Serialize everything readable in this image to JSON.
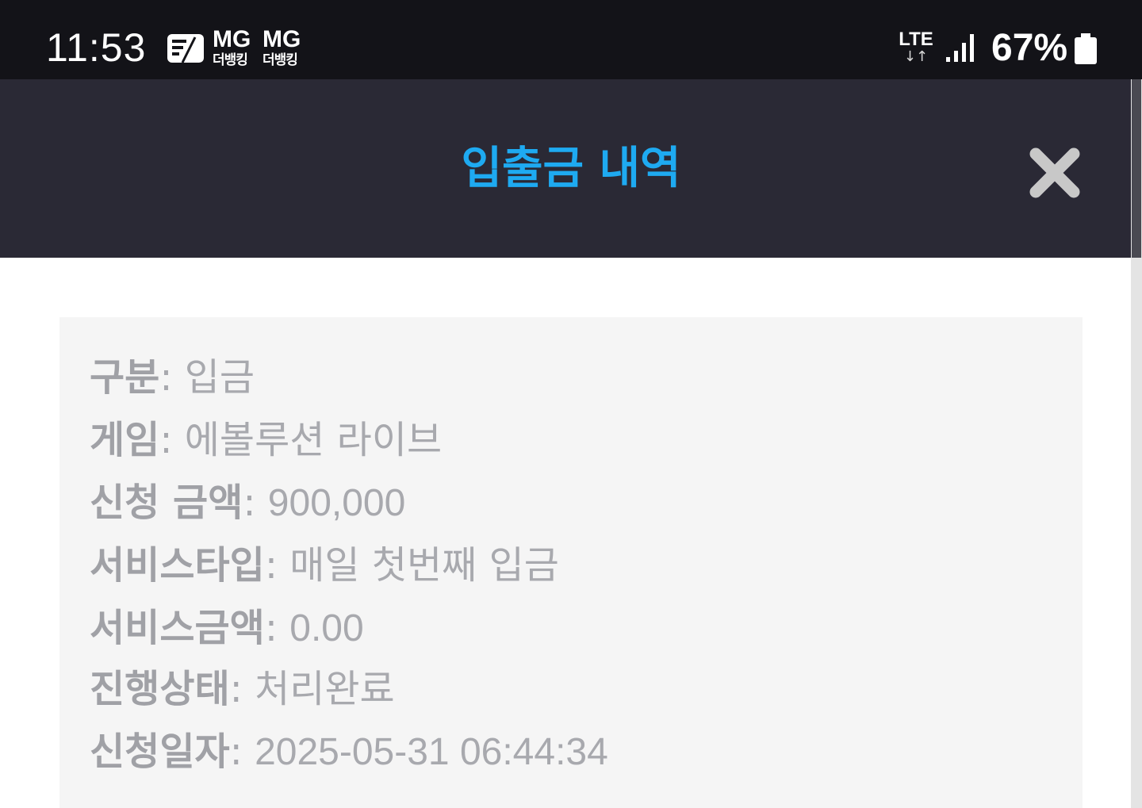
{
  "status_bar": {
    "time": "11:53",
    "notification_badges": [
      {
        "top": "MG",
        "sub": "더뱅킹"
      },
      {
        "top": "MG",
        "sub": "더뱅킹"
      }
    ],
    "network": "LTE",
    "network_arrows": "↓↑",
    "battery_percent": "67%",
    "battery_level": 0.67,
    "icons": [
      "news-card-icon",
      "signal-icon",
      "battery-icon"
    ]
  },
  "modal": {
    "title": "입출금 내역",
    "title_color": "#1eaaf1",
    "header_bg": "#2a2935",
    "close_icon": "close-icon"
  },
  "details": {
    "rows": [
      {
        "label": "구분",
        "sep": ": ",
        "value": "입금"
      },
      {
        "label": "게임",
        "sep": ": ",
        "value": "에볼루션 라이브"
      },
      {
        "label": "신청 금액",
        "sep": ": ",
        "value": "900,000"
      },
      {
        "label": "서비스타입",
        "sep": ": ",
        "value": "매일 첫번째 입금"
      },
      {
        "label": "서비스금액",
        "sep": ": ",
        "value": "0.00"
      },
      {
        "label": "진행상태",
        "sep": ": ",
        "value": "처리완료"
      },
      {
        "label": "신청일자",
        "sep": ": ",
        "value": "2025-05-31 06:44:34"
      }
    ]
  }
}
